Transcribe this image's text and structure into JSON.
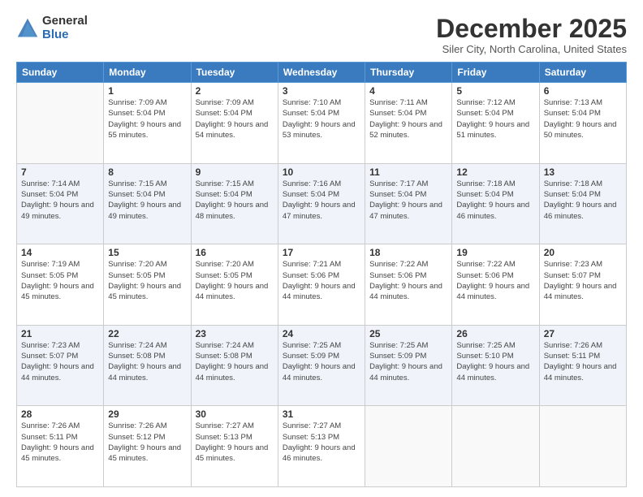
{
  "logo": {
    "general": "General",
    "blue": "Blue"
  },
  "title": "December 2025",
  "location": "Siler City, North Carolina, United States",
  "days_of_week": [
    "Sunday",
    "Monday",
    "Tuesday",
    "Wednesday",
    "Thursday",
    "Friday",
    "Saturday"
  ],
  "weeks": [
    [
      {
        "day": "",
        "sunrise": "",
        "sunset": "",
        "daylight": ""
      },
      {
        "day": "1",
        "sunrise": "Sunrise: 7:09 AM",
        "sunset": "Sunset: 5:04 PM",
        "daylight": "Daylight: 9 hours and 55 minutes."
      },
      {
        "day": "2",
        "sunrise": "Sunrise: 7:09 AM",
        "sunset": "Sunset: 5:04 PM",
        "daylight": "Daylight: 9 hours and 54 minutes."
      },
      {
        "day": "3",
        "sunrise": "Sunrise: 7:10 AM",
        "sunset": "Sunset: 5:04 PM",
        "daylight": "Daylight: 9 hours and 53 minutes."
      },
      {
        "day": "4",
        "sunrise": "Sunrise: 7:11 AM",
        "sunset": "Sunset: 5:04 PM",
        "daylight": "Daylight: 9 hours and 52 minutes."
      },
      {
        "day": "5",
        "sunrise": "Sunrise: 7:12 AM",
        "sunset": "Sunset: 5:04 PM",
        "daylight": "Daylight: 9 hours and 51 minutes."
      },
      {
        "day": "6",
        "sunrise": "Sunrise: 7:13 AM",
        "sunset": "Sunset: 5:04 PM",
        "daylight": "Daylight: 9 hours and 50 minutes."
      }
    ],
    [
      {
        "day": "7",
        "sunrise": "Sunrise: 7:14 AM",
        "sunset": "Sunset: 5:04 PM",
        "daylight": "Daylight: 9 hours and 49 minutes."
      },
      {
        "day": "8",
        "sunrise": "Sunrise: 7:15 AM",
        "sunset": "Sunset: 5:04 PM",
        "daylight": "Daylight: 9 hours and 49 minutes."
      },
      {
        "day": "9",
        "sunrise": "Sunrise: 7:15 AM",
        "sunset": "Sunset: 5:04 PM",
        "daylight": "Daylight: 9 hours and 48 minutes."
      },
      {
        "day": "10",
        "sunrise": "Sunrise: 7:16 AM",
        "sunset": "Sunset: 5:04 PM",
        "daylight": "Daylight: 9 hours and 47 minutes."
      },
      {
        "day": "11",
        "sunrise": "Sunrise: 7:17 AM",
        "sunset": "Sunset: 5:04 PM",
        "daylight": "Daylight: 9 hours and 47 minutes."
      },
      {
        "day": "12",
        "sunrise": "Sunrise: 7:18 AM",
        "sunset": "Sunset: 5:04 PM",
        "daylight": "Daylight: 9 hours and 46 minutes."
      },
      {
        "day": "13",
        "sunrise": "Sunrise: 7:18 AM",
        "sunset": "Sunset: 5:04 PM",
        "daylight": "Daylight: 9 hours and 46 minutes."
      }
    ],
    [
      {
        "day": "14",
        "sunrise": "Sunrise: 7:19 AM",
        "sunset": "Sunset: 5:05 PM",
        "daylight": "Daylight: 9 hours and 45 minutes."
      },
      {
        "day": "15",
        "sunrise": "Sunrise: 7:20 AM",
        "sunset": "Sunset: 5:05 PM",
        "daylight": "Daylight: 9 hours and 45 minutes."
      },
      {
        "day": "16",
        "sunrise": "Sunrise: 7:20 AM",
        "sunset": "Sunset: 5:05 PM",
        "daylight": "Daylight: 9 hours and 44 minutes."
      },
      {
        "day": "17",
        "sunrise": "Sunrise: 7:21 AM",
        "sunset": "Sunset: 5:06 PM",
        "daylight": "Daylight: 9 hours and 44 minutes."
      },
      {
        "day": "18",
        "sunrise": "Sunrise: 7:22 AM",
        "sunset": "Sunset: 5:06 PM",
        "daylight": "Daylight: 9 hours and 44 minutes."
      },
      {
        "day": "19",
        "sunrise": "Sunrise: 7:22 AM",
        "sunset": "Sunset: 5:06 PM",
        "daylight": "Daylight: 9 hours and 44 minutes."
      },
      {
        "day": "20",
        "sunrise": "Sunrise: 7:23 AM",
        "sunset": "Sunset: 5:07 PM",
        "daylight": "Daylight: 9 hours and 44 minutes."
      }
    ],
    [
      {
        "day": "21",
        "sunrise": "Sunrise: 7:23 AM",
        "sunset": "Sunset: 5:07 PM",
        "daylight": "Daylight: 9 hours and 44 minutes."
      },
      {
        "day": "22",
        "sunrise": "Sunrise: 7:24 AM",
        "sunset": "Sunset: 5:08 PM",
        "daylight": "Daylight: 9 hours and 44 minutes."
      },
      {
        "day": "23",
        "sunrise": "Sunrise: 7:24 AM",
        "sunset": "Sunset: 5:08 PM",
        "daylight": "Daylight: 9 hours and 44 minutes."
      },
      {
        "day": "24",
        "sunrise": "Sunrise: 7:25 AM",
        "sunset": "Sunset: 5:09 PM",
        "daylight": "Daylight: 9 hours and 44 minutes."
      },
      {
        "day": "25",
        "sunrise": "Sunrise: 7:25 AM",
        "sunset": "Sunset: 5:09 PM",
        "daylight": "Daylight: 9 hours and 44 minutes."
      },
      {
        "day": "26",
        "sunrise": "Sunrise: 7:25 AM",
        "sunset": "Sunset: 5:10 PM",
        "daylight": "Daylight: 9 hours and 44 minutes."
      },
      {
        "day": "27",
        "sunrise": "Sunrise: 7:26 AM",
        "sunset": "Sunset: 5:11 PM",
        "daylight": "Daylight: 9 hours and 44 minutes."
      }
    ],
    [
      {
        "day": "28",
        "sunrise": "Sunrise: 7:26 AM",
        "sunset": "Sunset: 5:11 PM",
        "daylight": "Daylight: 9 hours and 45 minutes."
      },
      {
        "day": "29",
        "sunrise": "Sunrise: 7:26 AM",
        "sunset": "Sunset: 5:12 PM",
        "daylight": "Daylight: 9 hours and 45 minutes."
      },
      {
        "day": "30",
        "sunrise": "Sunrise: 7:27 AM",
        "sunset": "Sunset: 5:13 PM",
        "daylight": "Daylight: 9 hours and 45 minutes."
      },
      {
        "day": "31",
        "sunrise": "Sunrise: 7:27 AM",
        "sunset": "Sunset: 5:13 PM",
        "daylight": "Daylight: 9 hours and 46 minutes."
      },
      {
        "day": "",
        "sunrise": "",
        "sunset": "",
        "daylight": ""
      },
      {
        "day": "",
        "sunrise": "",
        "sunset": "",
        "daylight": ""
      },
      {
        "day": "",
        "sunrise": "",
        "sunset": "",
        "daylight": ""
      }
    ]
  ]
}
